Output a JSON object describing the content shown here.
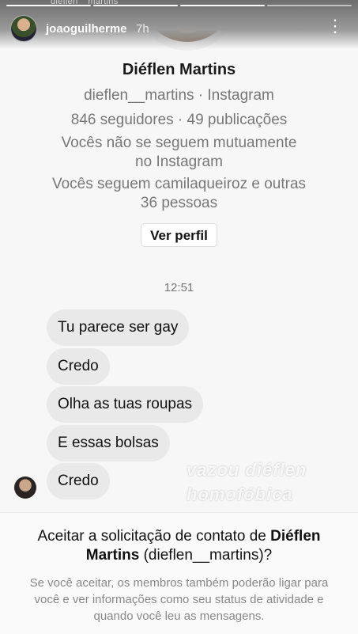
{
  "story": {
    "peek_text": "dieflen__martins",
    "username": "joaoguilherme",
    "time": "7h",
    "more_icon": "more-vertical-icon"
  },
  "profile": {
    "name": "Diéflen Martins",
    "handle_line": "dieflen__martins · Instagram",
    "stats_line": "846 seguidores · 49 publicações",
    "mutual_line1": "Vocês não se seguem mutuamente",
    "mutual_line2": "no Instagram",
    "follow_line1": "Vocês seguem camilaqueiroz e outras",
    "follow_line2": "36 pessoas",
    "view_profile_label": "Ver perfil"
  },
  "chat": {
    "timestamp": "12:51",
    "messages": [
      "Tu parece ser gay",
      "Credo",
      "Olha as tuas roupas",
      "E essas bolsas",
      "Credo"
    ]
  },
  "watermark": {
    "line1": "vazou diéflen",
    "line2": "homofóbica"
  },
  "request": {
    "title_prefix": "Aceitar a solicitação de contato de ",
    "title_name": "Diéflen Martins",
    "title_suffix": " (dieflen__martins)?",
    "description": "Se você aceitar, os membros também poderão ligar para você e ver informações como seu status de atividade e quando você leu as mensagens."
  }
}
